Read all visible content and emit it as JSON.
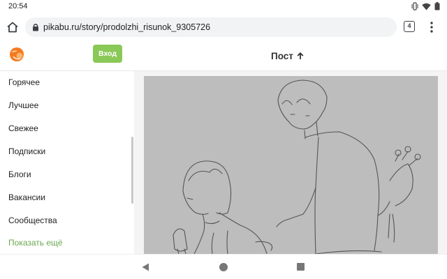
{
  "status_bar": {
    "time": "20:54",
    "icons": [
      "vibrate-icon",
      "wifi-icon",
      "battery-icon"
    ]
  },
  "browser": {
    "url": "pikabu.ru/story/prodolzhi_risunok_9305726",
    "tab_count": "4"
  },
  "header": {
    "login_label": "Вход",
    "title": "Пост"
  },
  "sidebar": {
    "items": [
      {
        "label": "Горячее"
      },
      {
        "label": "Лучшее"
      },
      {
        "label": "Свежее"
      },
      {
        "label": "Подписки"
      },
      {
        "label": "Блоги"
      },
      {
        "label": "Вакансии"
      },
      {
        "label": "Сообщества"
      }
    ],
    "more_label": "Показать ещё"
  },
  "content": {
    "image_description_icon": "post-drawing-image"
  },
  "colors": {
    "brand_orange": "#f47a1f",
    "accent_green": "#8ac858",
    "link_green": "#6aa84f"
  }
}
